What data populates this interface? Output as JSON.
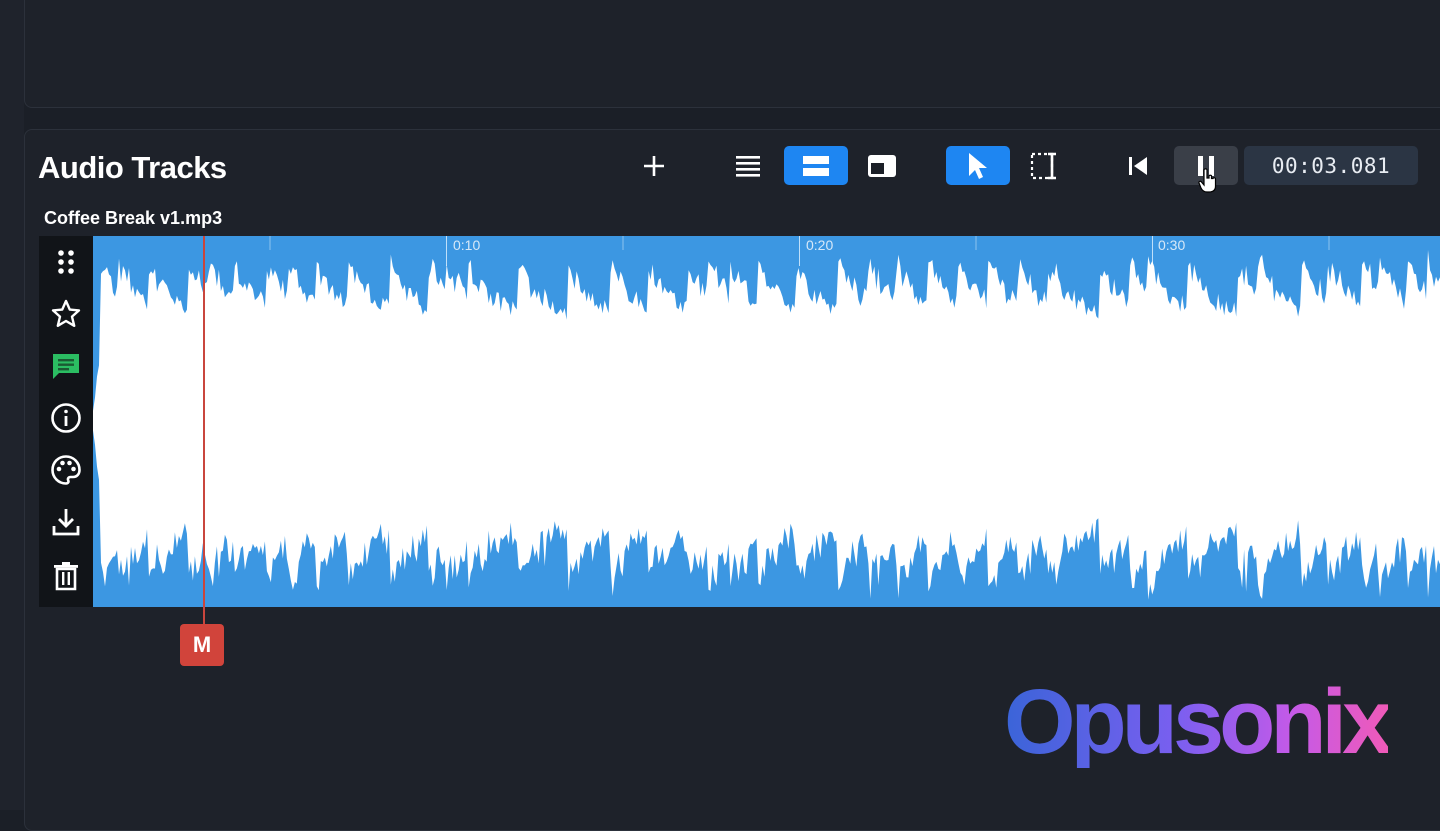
{
  "panel": {
    "title": "Audio Tracks"
  },
  "toolbar": {
    "add_icon": "plus-icon",
    "view_list_icon": "list-view-icon",
    "view_expanded_icon": "expanded-view-icon",
    "view_pip_icon": "picture-in-picture-icon",
    "select_tool_icon": "cursor-icon",
    "range_tool_icon": "range-select-icon",
    "skip_start_icon": "skip-to-start-icon",
    "pause_icon": "pause-icon",
    "time": "00:03.081",
    "active_color": "#1e86f2"
  },
  "track": {
    "name": "Coffee Break v1.mp3",
    "wave_color": "#3c97e2",
    "timeline_ticks": [
      "0:10",
      "0:20",
      "0:30"
    ],
    "sidebar_icons": [
      "drag-handle-icon",
      "star-icon",
      "comment-icon",
      "info-icon",
      "palette-icon",
      "download-icon",
      "trash-icon"
    ]
  },
  "marker": {
    "label": "M",
    "color": "#d1443b"
  },
  "brand": {
    "logo": "Opusonix"
  }
}
